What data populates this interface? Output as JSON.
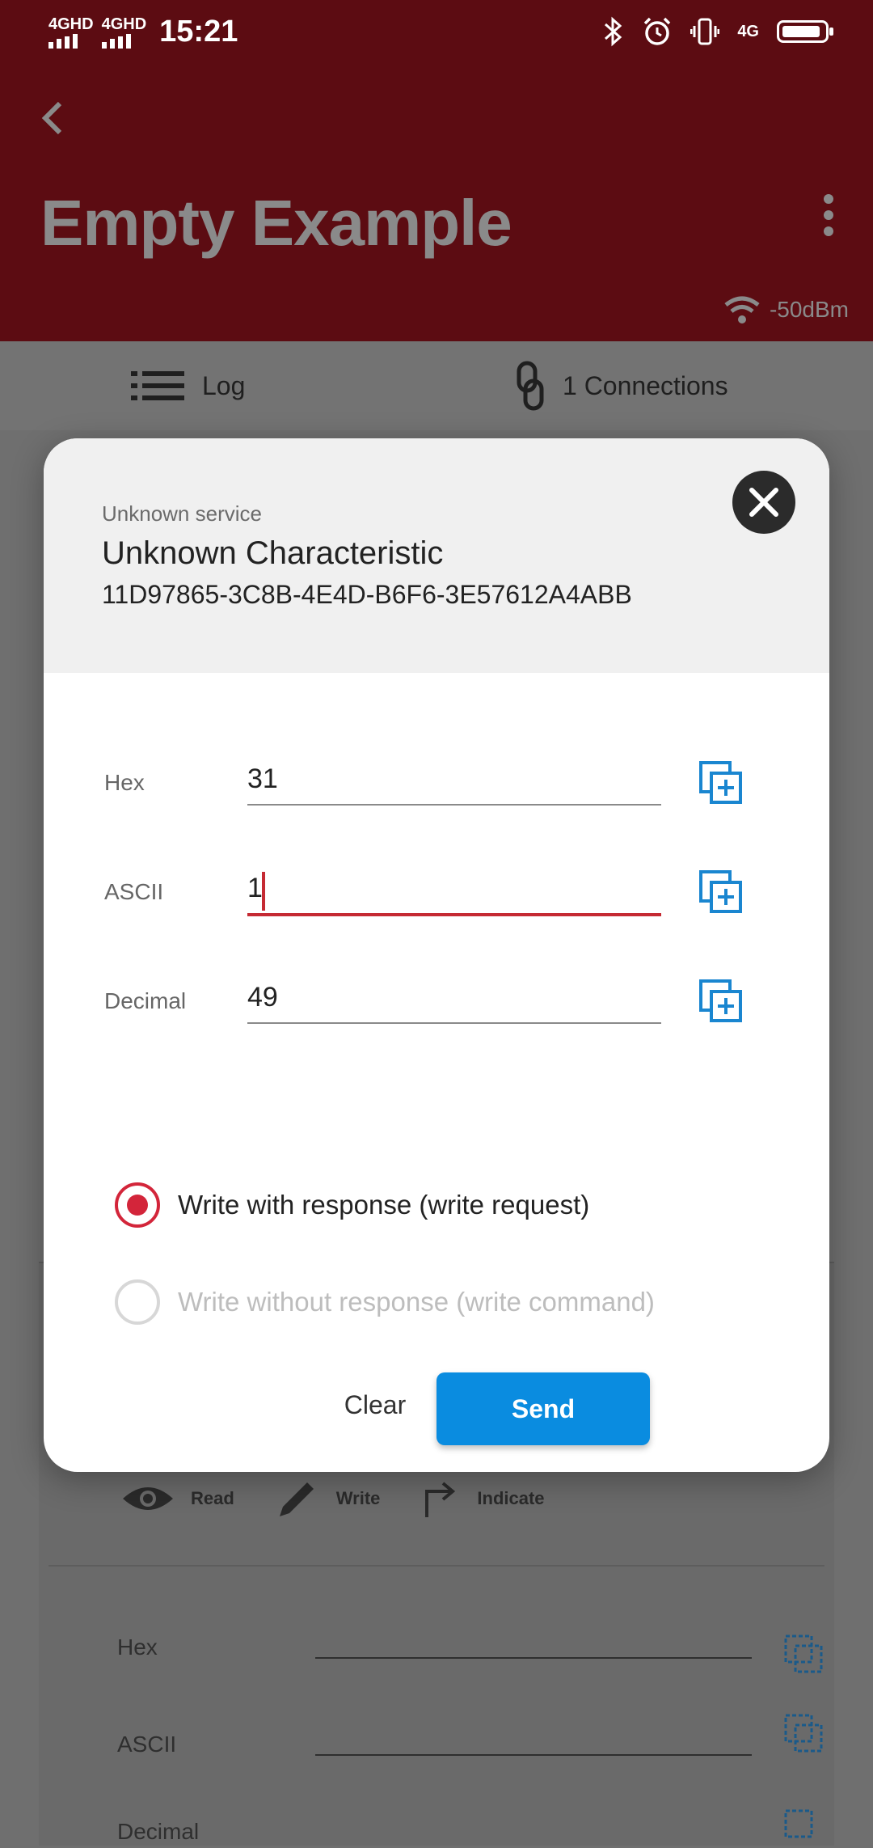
{
  "status_bar": {
    "network_1": "4GHD",
    "network_2": "4GHD",
    "time": "15:21",
    "network_right": "4G"
  },
  "app_bar": {
    "title": "Empty Example",
    "rssi": "-50dBm"
  },
  "tabs": {
    "log_label": "Log",
    "connections_label": "1 Connections"
  },
  "background": {
    "actions": [
      {
        "label": "Read",
        "icon": "eye-icon"
      },
      {
        "label": "Write",
        "icon": "pencil-icon"
      },
      {
        "label": "Indicate",
        "icon": "indicate-arrow-icon"
      }
    ],
    "fields": [
      {
        "label": "Hex"
      },
      {
        "label": "ASCII"
      },
      {
        "label": "Decimal"
      }
    ]
  },
  "dialog": {
    "service": "Unknown service",
    "characteristic": "Unknown Characteristic",
    "uuid": "11D97865-3C8B-4E4D-B6F6-3E57612A4ABB",
    "fields": {
      "hex_label": "Hex",
      "hex_value": "31",
      "ascii_label": "ASCII",
      "ascii_value": "1",
      "decimal_label": "Decimal",
      "decimal_value": "49"
    },
    "write_options": {
      "with_response": "Write with response (write request)",
      "without_response": "Write without response (write command)",
      "selected": "with_response"
    },
    "clear_label": "Clear",
    "send_label": "Send"
  },
  "colors": {
    "app_bar_bg": "#5c0c12",
    "accent_red": "#d3253a",
    "send_blue": "#0a8ce0",
    "copy_icon_blue": "#1a86d0"
  }
}
